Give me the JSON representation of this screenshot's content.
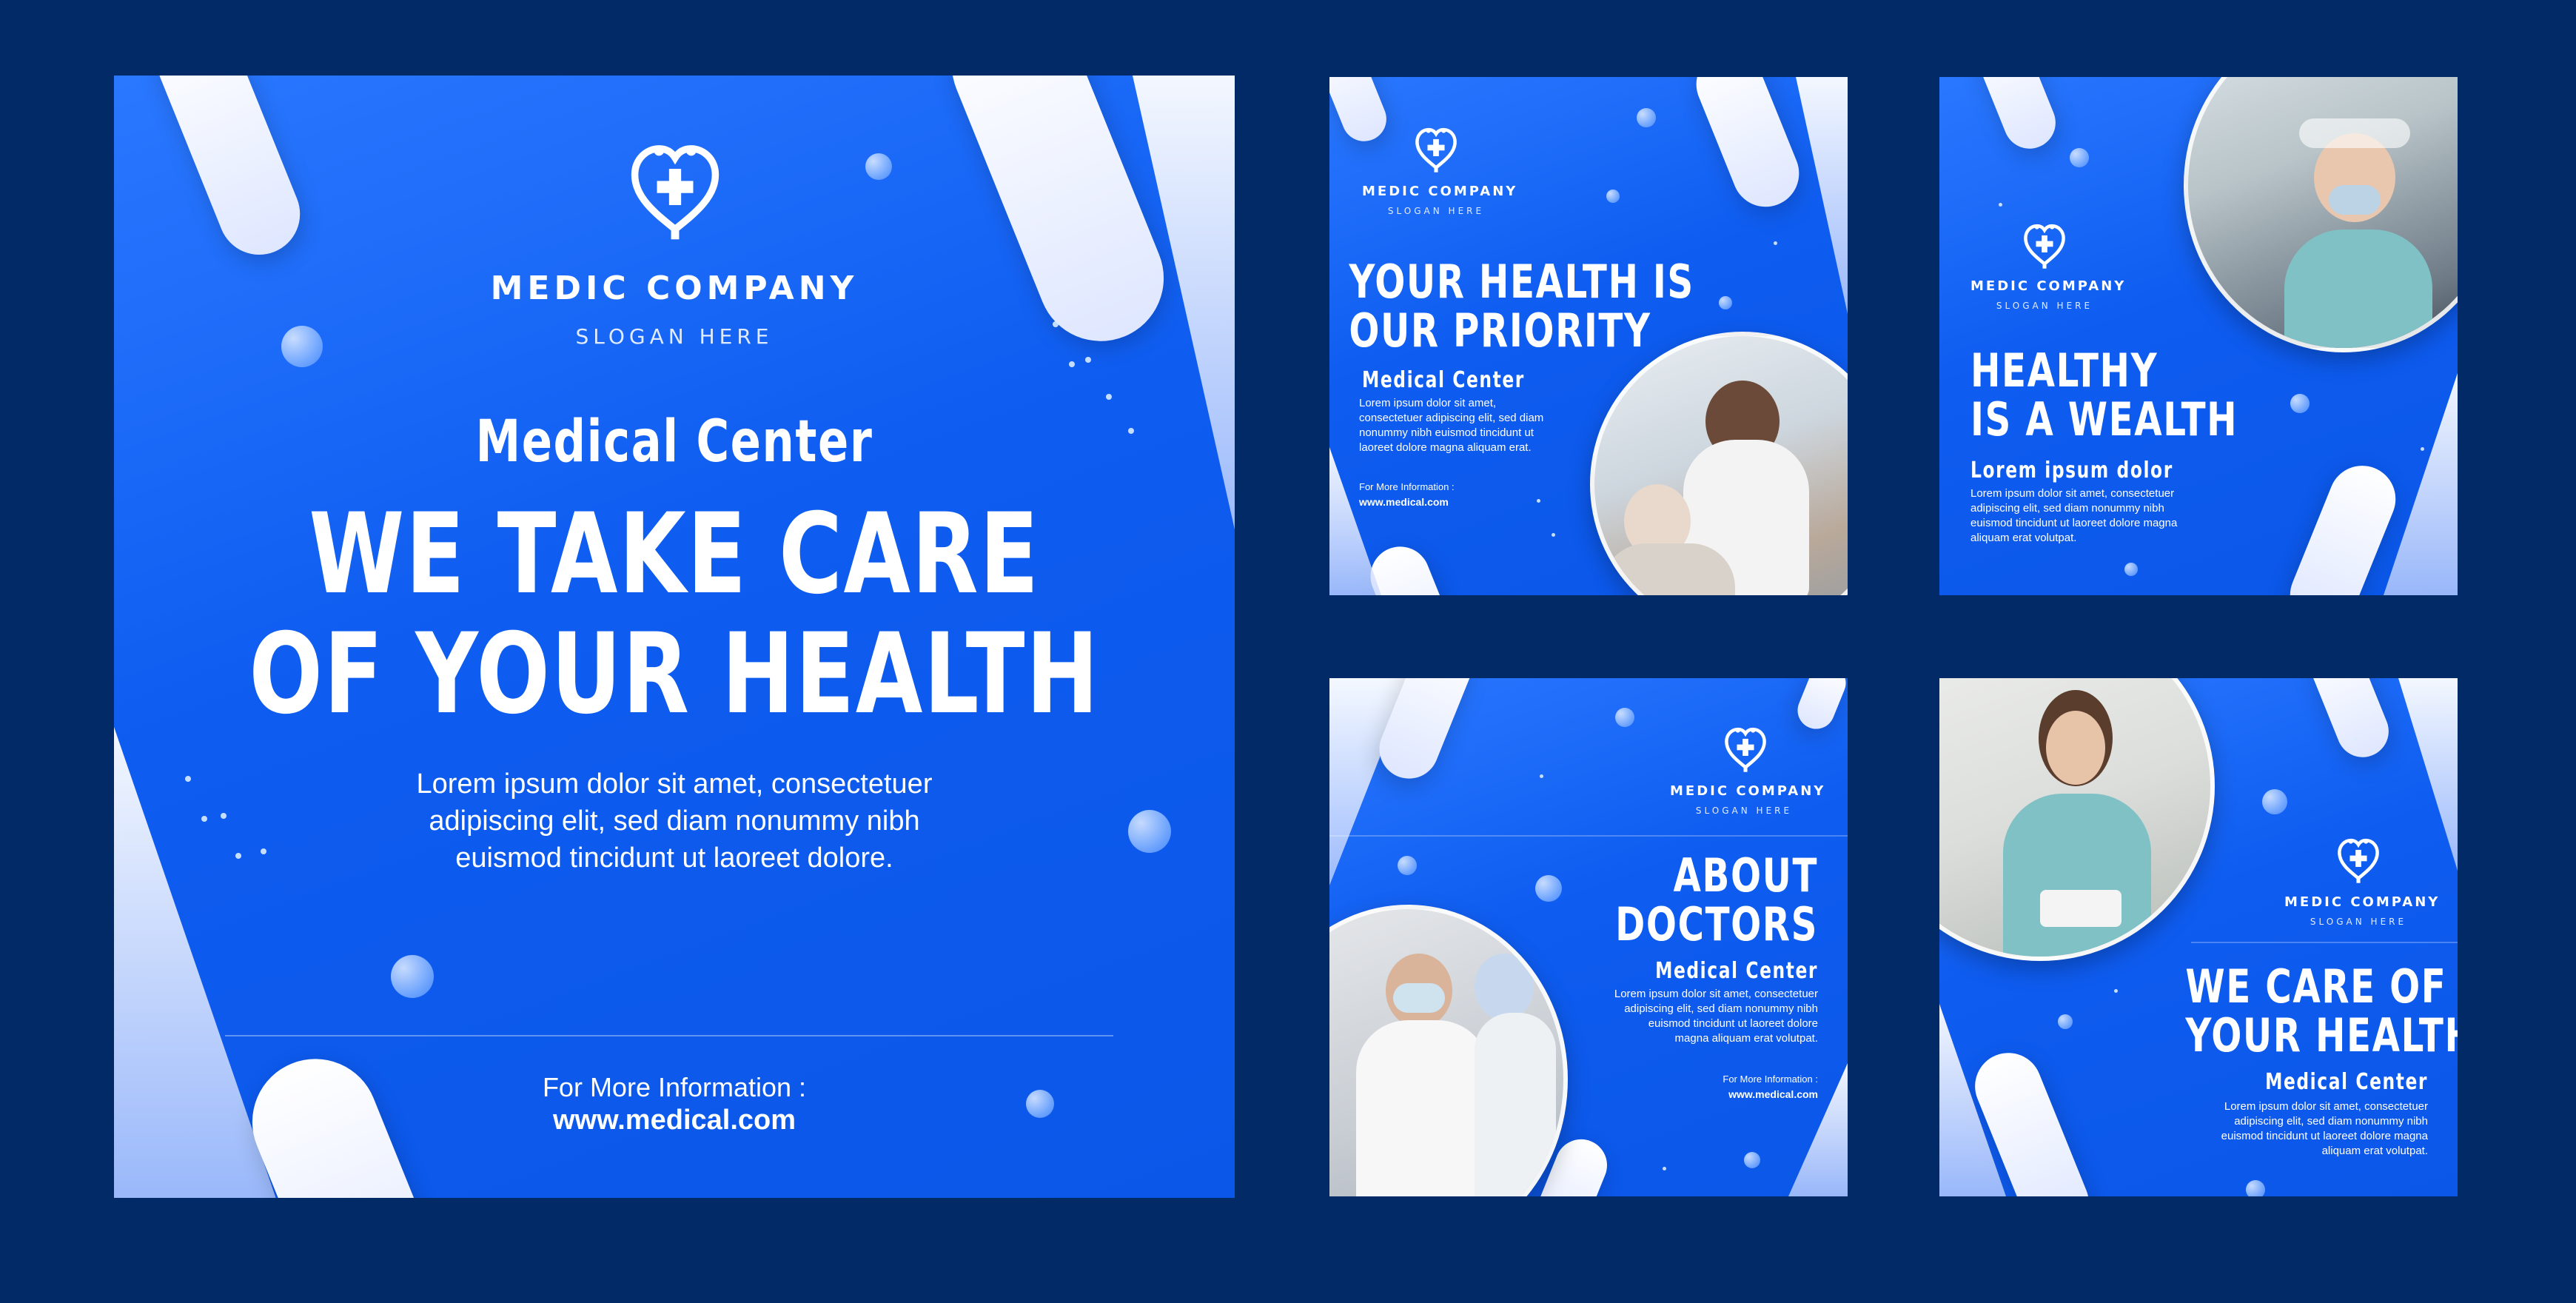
{
  "colors": {
    "background": "#022a66",
    "card_blue": "#0b57e8",
    "white": "#ffffff"
  },
  "brand": {
    "name": "MEDIC COMPANY",
    "slogan": "SLOGAN HERE",
    "logo_icon": "heart-cross-stethoscope-icon"
  },
  "main_card": {
    "subtitle": "Medical Center",
    "headline_line1": "WE TAKE CARE",
    "headline_line2": "OF YOUR HEALTH",
    "body_line1": "Lorem ipsum dolor sit amet, consectetuer",
    "body_line2": "adipiscing elit, sed diam nonummy nibh",
    "body_line3": "euismod tincidunt ut laoreet dolore.",
    "info_label": "For More Information :",
    "website": "www.medical.com"
  },
  "card2": {
    "headline_line1": "YOUR HEALTH IS",
    "headline_line2": "OUR PRIORITY",
    "subtitle": "Medical Center",
    "body_line1": "Lorem ipsum dolor sit amet,",
    "body_line2": "consectetuer adipiscing elit, sed diam",
    "body_line3": "nonummy nibh euismod tincidunt ut",
    "body_line4": "laoreet dolore magna aliquam erat.",
    "info_label": "For More Information :",
    "website": "www.medical.com",
    "photo_icon": "nurse-elderly-patient-photo"
  },
  "card3": {
    "headline_line1": "HEALTHY",
    "headline_line2": "IS A WEALTH",
    "subtitle": "Lorem ipsum dolor",
    "body_line1": "Lorem ipsum dolor sit amet, consectetuer",
    "body_line2": "adipiscing elit, sed diam nonummy nibh",
    "body_line3": "euismod tincidunt ut laoreet dolore magna",
    "body_line4": "aliquam erat volutpat.",
    "photo_icon": "face-shield-nurse-photo"
  },
  "card4": {
    "headline_line1": "ABOUT",
    "headline_line2": "DOCTORS",
    "subtitle": "Medical Center",
    "body_line1": "Lorem ipsum dolor sit amet, consectetuer",
    "body_line2": "adipiscing elit, sed diam nonummy nibh",
    "body_line3": "euismod tincidunt ut laoreet dolore",
    "body_line4": "magna aliquam erat volutpat.",
    "info_label": "For More Information :",
    "website": "www.medical.com",
    "photo_icon": "two-doctors-masks-photo"
  },
  "card5": {
    "headline_line1": "WE CARE OF",
    "headline_line2": "YOUR HEALTH",
    "subtitle": "Medical Center",
    "body_line1": "Lorem ipsum dolor sit amet, consectetuer",
    "body_line2": "adipiscing elit, sed diam nonummy nibh",
    "body_line3": "euismod tincidunt ut laoreet dolore magna",
    "body_line4": "aliquam erat volutpat.",
    "photo_icon": "nurse-tablet-photo"
  }
}
